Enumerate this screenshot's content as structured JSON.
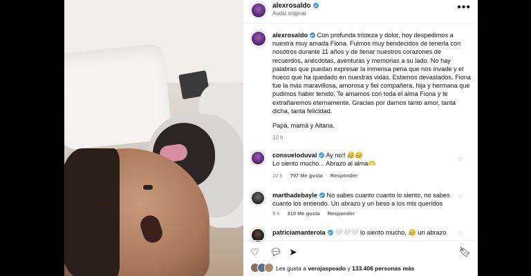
{
  "post": {
    "username": "alexrosaldo",
    "audio": "Audio original",
    "caption": "Con profunda tristeza y dolor, hoy despedimos a nuestra muy amada Fiona. Fuimos muy bendecidos de tenerla con nosotros durante 11 años y de llenar nuestros corazones de recuerdos, anécdotas, aventuras y memorias a su lado. No hay palabras que puedan expresar la inmensa pena que nos invade y el hueco que ha quedado en nuestras vidas. Estamos devastados. Fiona fue la más maravillosa, amorosa y fiel compañera, hija y hermana que pudimos haber tenido. Te amamos con toda el alma Fiona y te extrañaremos eternamente. Gracias por darnos tanto amor, tanta dicha, tanta felicidad.",
    "signoff": "Papá, mamá y Aitana.",
    "time": "10 h"
  },
  "comments": [
    {
      "username": "consueloduval",
      "line1": "Ay no!! 😥😥",
      "line2": "Lo siento mucho... Abrazo al alma🫶",
      "time": "10 h",
      "likes": "797 Me gusta",
      "reply": "Responder"
    },
    {
      "username": "marthadebayle",
      "text": "No sabes cuanto cuanto lo siento, no sabes cuanto los entiendo. Un abrazo y un beso a los mis queridos",
      "time": "9 h",
      "likes": "310 Me gusta",
      "reply": "Responder"
    },
    {
      "username": "patriciamanterola",
      "text": "🤍🤍🤍 lo siento mucho, 😥 un abrazo"
    }
  ],
  "likes": {
    "prefix": "Les gusta a ",
    "user": "verojaspeado",
    "middle": " y ",
    "count": "133.406 personas más"
  },
  "icons": {
    "more": "more-options-icon",
    "heart": "heart-icon",
    "comment": "comment-icon",
    "share": "share-icon",
    "save": "bookmark-icon"
  },
  "colors": {
    "verified": "#3897f0",
    "text": "#111111",
    "muted": "#777777"
  }
}
